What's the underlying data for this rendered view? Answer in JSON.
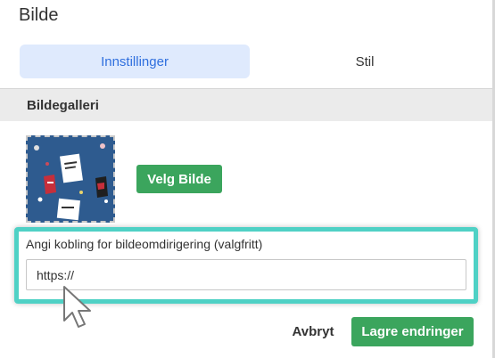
{
  "panel": {
    "title": "Bilde"
  },
  "tabs": [
    {
      "label": "Innstillinger",
      "active": true
    },
    {
      "label": "Stil",
      "active": false
    }
  ],
  "section": {
    "title": "Bildegalleri"
  },
  "gallery": {
    "image_icon": "black-friday-photo-thumbnail",
    "pick_button_label": "Velg Bilde"
  },
  "redirect": {
    "label": "Angi kobling for bildeomdirigering (valgfritt)",
    "value": "https://"
  },
  "actions": {
    "cancel_label": "Avbryt",
    "save_label": "Lagre endringer"
  },
  "colors": {
    "accent_green": "#3ba55d",
    "tab_active_bg": "#dfeafd",
    "tab_active_text": "#2f6fde",
    "highlight": "#4fd1c5"
  },
  "pointer_icon": "mouse-pointer-icon"
}
